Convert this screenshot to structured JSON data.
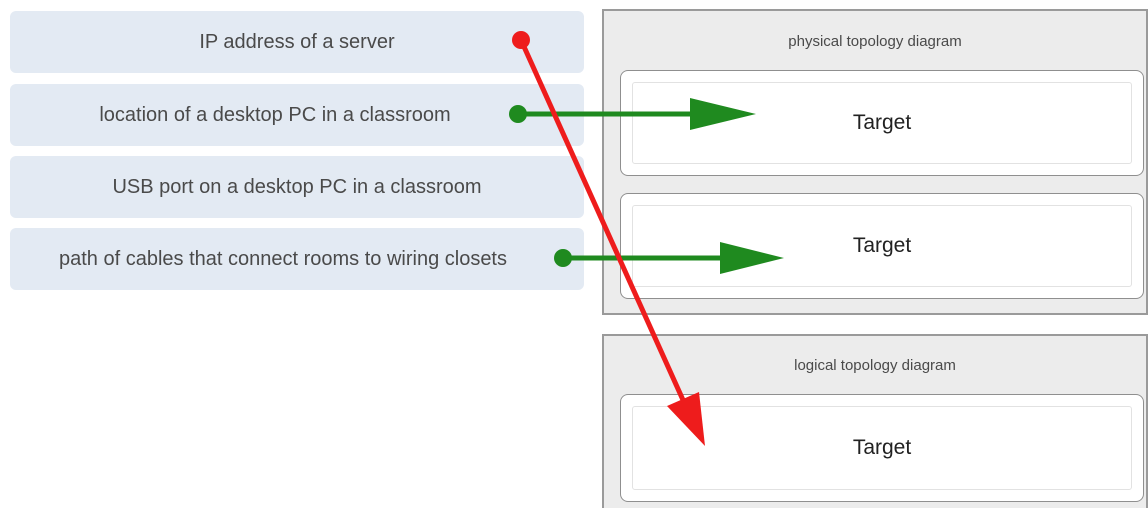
{
  "items": [
    {
      "label": "IP address of a server"
    },
    {
      "label": "location of a desktop PC in a classroom"
    },
    {
      "label": "USB port on a desktop PC in a classroom"
    },
    {
      "label": "path of cables that connect rooms to wiring closets"
    }
  ],
  "groups": {
    "physical": {
      "title": "physical topology diagram",
      "targets": [
        "Target",
        "Target"
      ]
    },
    "logical": {
      "title": "logical topology diagram",
      "targets": [
        "Target"
      ]
    }
  },
  "colors": {
    "item_background": "#e3eaf3",
    "group_background": "#ececec",
    "green_arrow": "#1f8a1f",
    "red_arrow": "#ee1c1c"
  }
}
